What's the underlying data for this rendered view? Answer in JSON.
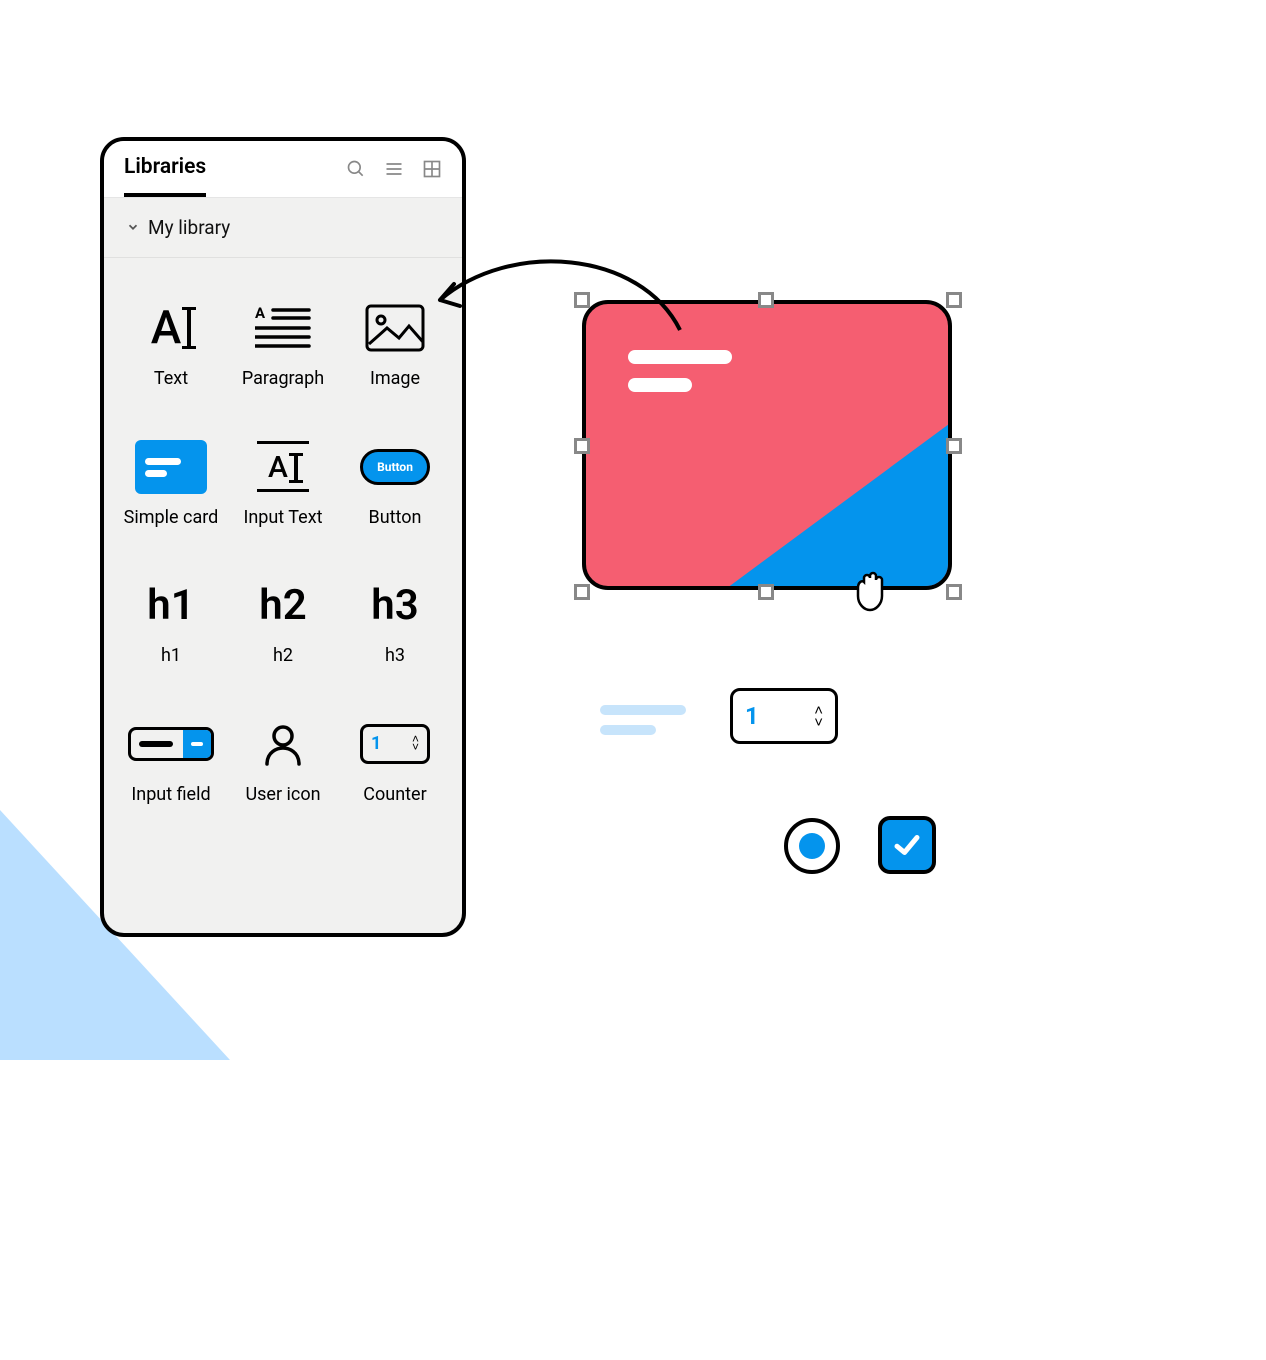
{
  "panel": {
    "tab_label": "Libraries",
    "section_label": "My library",
    "items": [
      {
        "label": "Text"
      },
      {
        "label": "Paragraph"
      },
      {
        "label": "Image"
      },
      {
        "label": "Simple card"
      },
      {
        "label": "Input Text"
      },
      {
        "label": "Button",
        "pill_text": "Button"
      },
      {
        "label": "h1",
        "glyph": "h1"
      },
      {
        "label": "h2",
        "glyph": "h2"
      },
      {
        "label": "h3",
        "glyph": "h3"
      },
      {
        "label": "Input field"
      },
      {
        "label": "User icon"
      },
      {
        "label": "Counter",
        "value": "1"
      }
    ]
  },
  "canvas": {
    "counter_value": "1"
  }
}
